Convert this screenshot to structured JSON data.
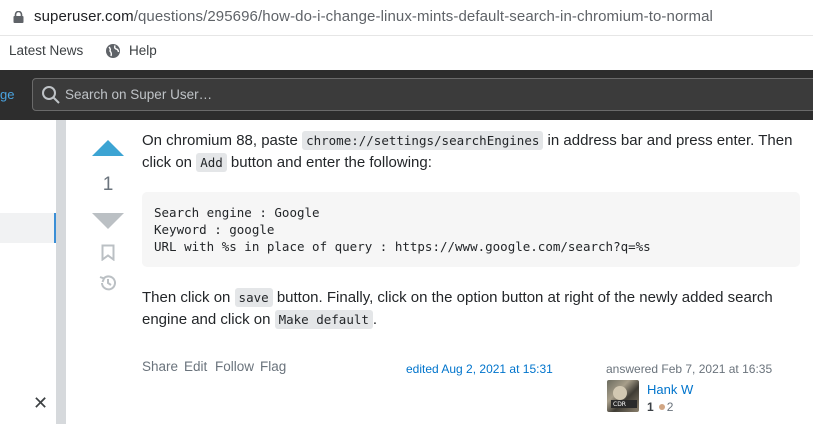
{
  "browser": {
    "url_host": "superuser.com",
    "url_path": "/questions/295696/how-do-i-change-linux-mints-default-search-in-chromium-to-normal",
    "bookmarks": [
      "Latest News",
      "Help"
    ]
  },
  "site_header": {
    "left_fragment": "ge",
    "search_placeholder": "Search on Super User…"
  },
  "sidebar": {
    "close_label": "✕"
  },
  "vote": {
    "count": "1"
  },
  "post": {
    "p1_a": "On chromium 88, paste ",
    "p1_code1": "chrome://settings/searchEngines",
    "p1_b": " in address bar and press enter. Then click on ",
    "p1_code2": "Add",
    "p1_c": " button and enter the following:",
    "code_lines": [
      "Search engine : Google",
      "Keyword : google",
      "URL with %s in place of query : https://www.google.com/search?q=%s"
    ],
    "p2_a": "Then click on ",
    "p2_code1": "save",
    "p2_b": " button. Finally, click on the option button at right of the newly added search engine and click on ",
    "p2_code2": "Make default",
    "p2_c": "."
  },
  "post_menu": {
    "share": "Share",
    "edit": "Edit",
    "follow": "Follow",
    "flag": "Flag"
  },
  "edited": "edited Aug 2, 2021 at 15:31",
  "answered": "answered Feb 7, 2021 at 16:35",
  "user": {
    "name": "Hank W",
    "reputation": "1",
    "bronze": "2",
    "avatar_text": "CDR"
  },
  "colors": {
    "upvote": "#3ca4d3",
    "link": "#0074cc",
    "header_bg": "#2d2d2d"
  }
}
